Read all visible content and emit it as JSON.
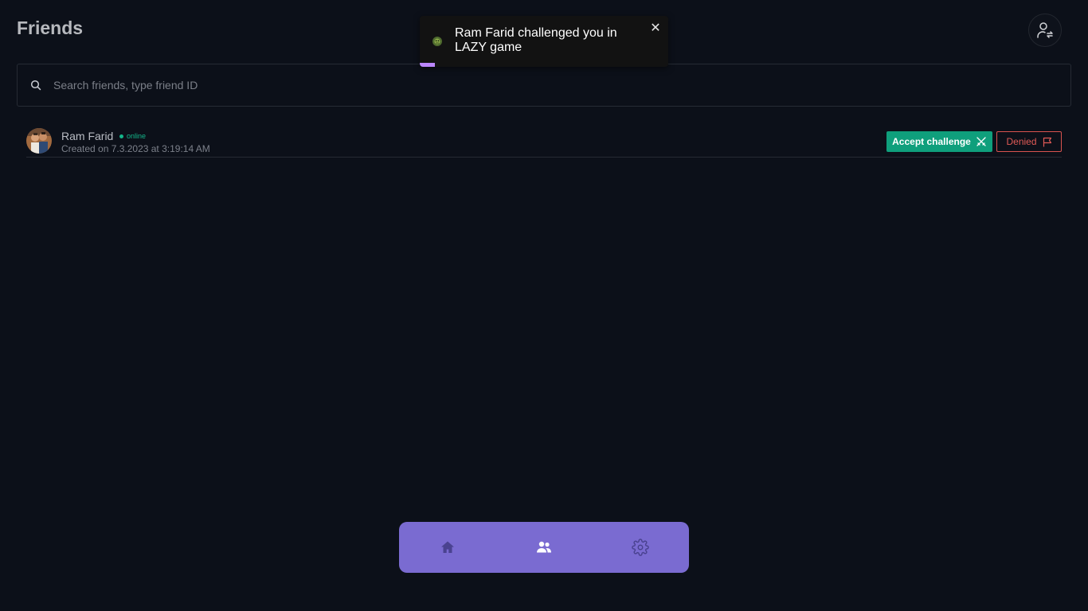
{
  "header": {
    "title": "Friends",
    "profile_icon": "user-switch-icon"
  },
  "search": {
    "placeholder": "Search friends, type friend ID",
    "value": "",
    "icon": "search-icon"
  },
  "friends": [
    {
      "name": "Ram Farid",
      "status": "online",
      "created": "Created on 7.3.2023 at 3:19:14 AM",
      "accept_label": "Accept challenge",
      "accept_icon": "crossed-swords-icon",
      "denied_label": "Denied",
      "denied_icon": "flag-icon"
    }
  ],
  "toast": {
    "message": "Ram Farid challenged you in LAZY game",
    "icon": "game-badge-icon",
    "close_glyph": "✕",
    "progress": 0.06
  },
  "nav": {
    "items": [
      {
        "name": "home",
        "icon": "home-icon",
        "active": false
      },
      {
        "name": "friends",
        "icon": "friends-icon",
        "active": true
      },
      {
        "name": "settings",
        "icon": "gear-icon",
        "active": false
      }
    ]
  },
  "colors": {
    "background": "#0c1019",
    "accept": "#0f9f7c",
    "denied": "#d9534f",
    "online": "#14b58a",
    "nav": "#7a6bd1",
    "toast_progress": "#bb86fc"
  }
}
